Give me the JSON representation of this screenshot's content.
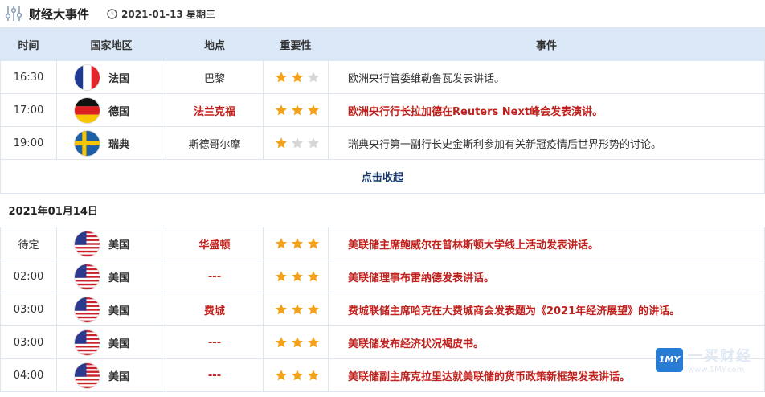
{
  "header": {
    "title": "财经大事件",
    "date": "2021-01-13 星期三"
  },
  "columns": [
    "时间",
    "国家地区",
    "地点",
    "重要性",
    "事件"
  ],
  "rows_day1": [
    {
      "time": "16:30",
      "flag": "france",
      "country": "法国",
      "place": "巴黎",
      "stars": 2,
      "event": "欧洲央行管委维勒鲁瓦发表讲话。",
      "high": false
    },
    {
      "time": "17:00",
      "flag": "germany",
      "country": "德国",
      "place": "法兰克福",
      "stars": 3,
      "event": "欧洲央行行长拉加德在Reuters Next峰会发表演讲。",
      "high": true
    },
    {
      "time": "19:00",
      "flag": "sweden",
      "country": "瑞典",
      "place": "斯德哥尔摩",
      "stars": 1,
      "event": "瑞典央行第一副行长史金斯利参加有关新冠疫情后世界形势的讨论。",
      "high": false
    }
  ],
  "collapse_label": "点击收起",
  "day2_label": "2021年01月14日",
  "rows_day2": [
    {
      "time": "待定",
      "flag": "usa",
      "country": "美国",
      "place": "华盛顿",
      "stars": 3,
      "event": "美联储主席鲍威尔在普林斯顿大学线上活动发表讲话。",
      "high": true
    },
    {
      "time": "02:00",
      "flag": "usa",
      "country": "美国",
      "place": "---",
      "stars": 3,
      "event": "美联储理事布雷纳德发表讲话。",
      "high": true
    },
    {
      "time": "03:00",
      "flag": "usa",
      "country": "美国",
      "place": "费城",
      "stars": 3,
      "event": "费城联储主席哈克在大费城商会发表题为《2021年经济展望》的讲话。",
      "high": true
    },
    {
      "time": "03:00",
      "flag": "usa",
      "country": "美国",
      "place": "---",
      "stars": 3,
      "event": "美联储发布经济状况褐皮书。",
      "high": true
    },
    {
      "time": "04:00",
      "flag": "usa",
      "country": "美国",
      "place": "---",
      "stars": 3,
      "event": "美联储副主席克拉里达就美联储的货币政策新框架发表讲话。",
      "high": true
    }
  ],
  "watermark": {
    "badge": "1MY",
    "name": "一买财经",
    "url": "www.1MY.com"
  },
  "colors": {
    "header_bg": "#dbe8f7",
    "high": "#c0211c",
    "star_on": "#f4a21b",
    "star_off": "#d6d6d6"
  }
}
